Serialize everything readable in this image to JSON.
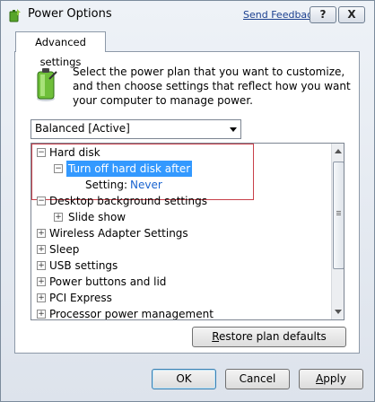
{
  "window": {
    "title": "Power Options",
    "send_feedback": "Send Feedback",
    "help_glyph": "?",
    "close_glyph": "X"
  },
  "tab": {
    "label": "Advanced settings"
  },
  "description": "Select the power plan that you want to customize, and then choose settings that reflect how you want your computer to manage power.",
  "plan_select": {
    "value": "Balanced [Active]"
  },
  "tree": {
    "expanded_glyph": "−",
    "collapsed_glyph": "+",
    "items": [
      {
        "label": "Hard disk"
      },
      {
        "label": "Turn off hard disk after"
      },
      {
        "setting_label": "Setting:",
        "setting_value": "Never"
      },
      {
        "label": "Desktop background settings"
      },
      {
        "label": "Slide show"
      },
      {
        "label": "Wireless Adapter Settings"
      },
      {
        "label": "Sleep"
      },
      {
        "label": "USB settings"
      },
      {
        "label": "Power buttons and lid"
      },
      {
        "label": "PCI Express"
      },
      {
        "label": "Processor power management"
      }
    ]
  },
  "buttons": {
    "restore_first": "R",
    "restore_rest": "estore plan defaults",
    "ok": "OK",
    "cancel": "Cancel",
    "apply_first": "A",
    "apply_rest": "pply"
  },
  "colors": {
    "selection": "#3399ff",
    "setting_value": "#1a64d0",
    "highlight_border": "#c8404a"
  },
  "icons": [
    "power-options-icon",
    "battery-icon",
    "help-icon",
    "close-icon",
    "dropdown-arrow-icon",
    "expand-icon",
    "collapse-icon"
  ]
}
